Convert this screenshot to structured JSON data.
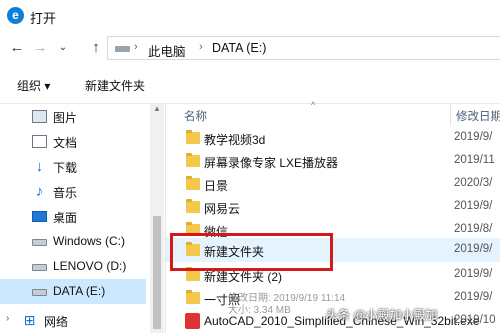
{
  "window": {
    "title": "打开"
  },
  "address": {
    "segments": [
      "此电脑",
      "DATA (E:)"
    ]
  },
  "toolbar": {
    "organize_label": "组织 ▾",
    "new_folder_label": "新建文件夹"
  },
  "sidebar": {
    "items": [
      {
        "label": "图片",
        "icon": "picture-icon"
      },
      {
        "label": "文档",
        "icon": "document-icon"
      },
      {
        "label": "下载",
        "icon": "download-icon"
      },
      {
        "label": "音乐",
        "icon": "music-icon"
      },
      {
        "label": "桌面",
        "icon": "desktop-icon"
      },
      {
        "label": "Windows (C:)",
        "icon": "drive-icon"
      },
      {
        "label": "LENOVO (D:)",
        "icon": "drive-icon"
      },
      {
        "label": "DATA (E:)",
        "icon": "drive-icon",
        "selected": true
      },
      {
        "label": "网络",
        "icon": "network-icon"
      }
    ]
  },
  "columns": {
    "name": "名称",
    "date": "修改日期"
  },
  "files": [
    {
      "name": "教学视频3d",
      "date": "2019/9/"
    },
    {
      "name": "屏幕录像专家 LXE播放器",
      "date": "2019/11"
    },
    {
      "name": "日景",
      "date": "2020/3/"
    },
    {
      "name": "网易云",
      "date": "2019/9/"
    },
    {
      "name": "微信",
      "date": "2019/8/"
    },
    {
      "name": "新建文件夹",
      "date": "2019/9/",
      "highlighted": true
    },
    {
      "name": "新建文件夹 (2)",
      "date": "2019/9/"
    },
    {
      "name": "一寸照",
      "date": "2019/9/"
    },
    {
      "name": "AutoCAD_2010_Simplified_Chinese_Win_32bit.exe",
      "date": "2019/10"
    }
  ],
  "tooltip": {
    "line1": "修改日期: 2019/9/19 11:14",
    "line2": "大小: 3.34 MB"
  },
  "watermark": "头条 @小殿加小殿加",
  "colors": {
    "selection": "#cce8ff",
    "hover": "#e5f3ff",
    "highlight_border": "#d21a1a",
    "folder": "#f4c84b"
  }
}
